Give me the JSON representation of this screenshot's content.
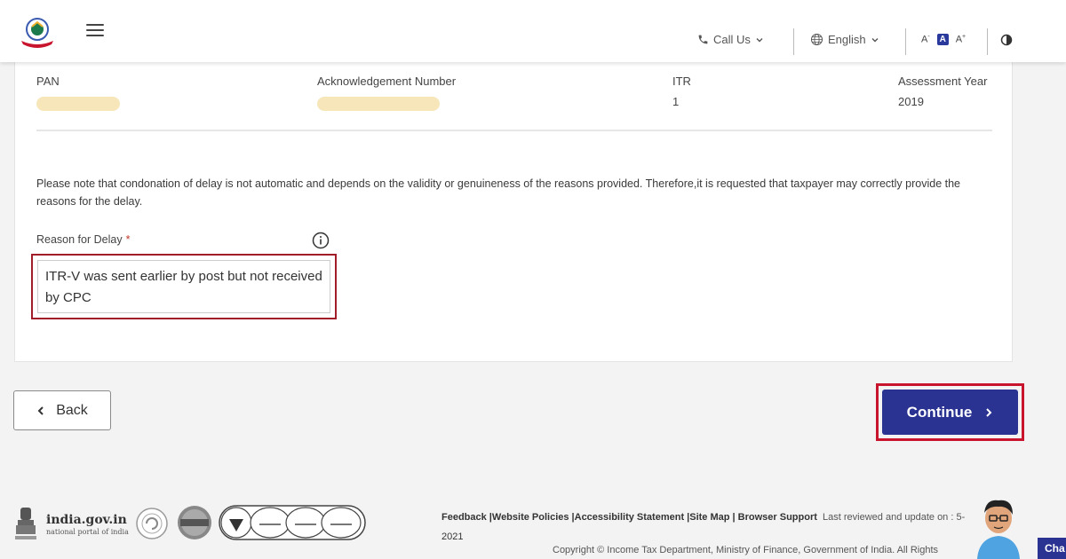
{
  "header": {
    "call_us_label": "Call Us",
    "language_label": "English",
    "font_decrease": "A",
    "font_default": "A",
    "font_increase": "A"
  },
  "details": {
    "pan_label": "PAN",
    "pan_value": "",
    "ack_label": "Acknowledgement Number",
    "ack_value": "",
    "itr_label": "ITR",
    "itr_value": "1",
    "ay_label": "Assessment Year",
    "ay_value": "2019"
  },
  "note": "Please note that condonation of delay is not automatic and depends on the validity or genuineness of the reasons provided. Therefore,it is requested that taxpayer may correctly provide the reasons for the delay.",
  "reason": {
    "label": "Reason for Delay",
    "required_mark": "*",
    "value": "ITR-V was sent earlier by post but not received by CPC"
  },
  "buttons": {
    "back_label": "Back",
    "continue_label": "Continue"
  },
  "footer": {
    "site_name": "india.gov.in",
    "site_tagline": "national portal of india",
    "links_line": "Feedback |Website Policies |Accessibility Statement |Site Map | Browser Support",
    "reviewed_text": "Last reviewed and update on : 5-",
    "reviewed_year": "2021",
    "copyright": "Copyright © Income Tax Department, Ministry of Finance, Government of India. All Rights",
    "chat_label": "Cha"
  },
  "colors": {
    "primary": "#2a3391",
    "highlight_border": "#c8142d",
    "masked_fill": "#f6e6ba"
  },
  "icons": [
    "emblem-logo-icon",
    "hamburger-menu-icon",
    "phone-icon",
    "chevron-down-icon",
    "globe-icon",
    "info-icon",
    "contrast-icon",
    "chevron-left-icon",
    "chevron-right-icon"
  ]
}
